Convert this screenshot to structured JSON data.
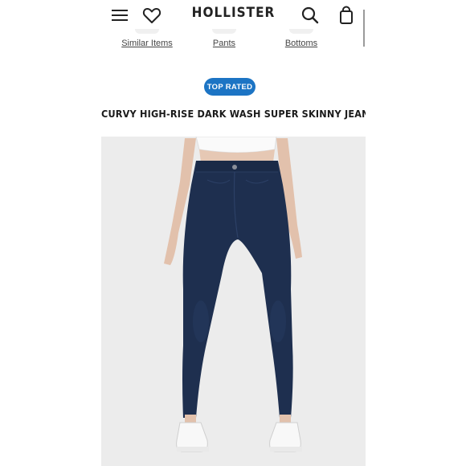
{
  "header": {
    "brand": "HOLLISTER",
    "icons": {
      "menu": "hamburger-menu-icon",
      "wishlist": "heart-icon",
      "search": "search-icon",
      "bag": "shopping-bag-icon"
    }
  },
  "categories": [
    {
      "label": "Similar Items"
    },
    {
      "label": "Pants"
    },
    {
      "label": "Bottoms"
    }
  ],
  "product": {
    "badge": "TOP RATED",
    "title": "CURVY HIGH-RISE DARK WASH SUPER SKINNY JEANS"
  },
  "colors": {
    "badge": "#1c74c4",
    "denim": "#1e2f4f",
    "photo_background": "#ececec"
  }
}
